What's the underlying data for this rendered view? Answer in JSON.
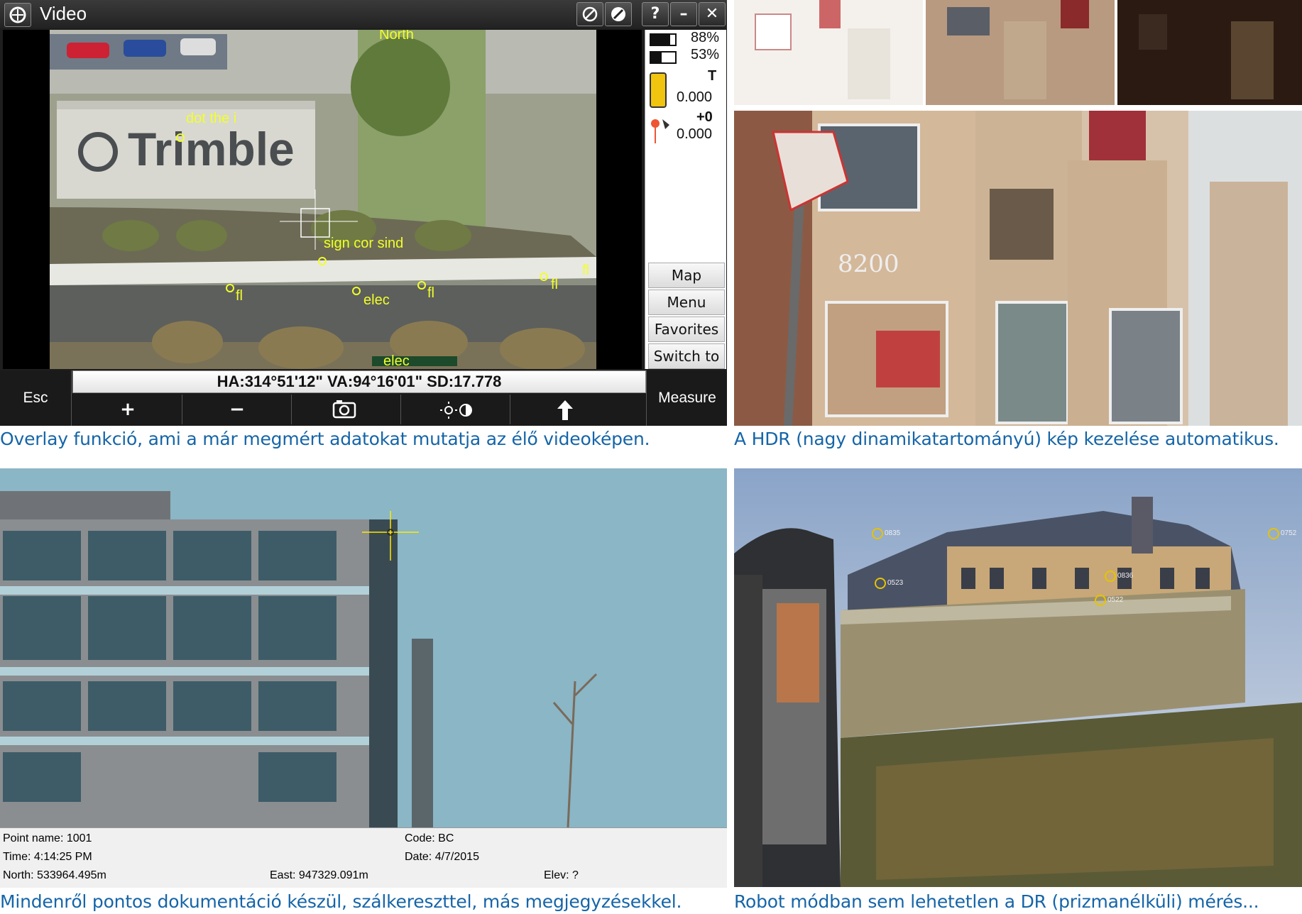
{
  "video_window": {
    "title": "Video",
    "side_panel": {
      "battery_1": "88%",
      "battery_2": "53%",
      "mode": "T",
      "value_1": "0.000",
      "offset": "+0",
      "value_2": "0.000",
      "buttons": [
        {
          "label": "Map"
        },
        {
          "label": "Menu"
        },
        {
          "label": "Favorites"
        },
        {
          "label": "Switch to"
        }
      ]
    },
    "readout": "HA:314°51'12\"  VA:94°16'01\"  SD:17.778",
    "esc_label": "Esc",
    "measure_label": "Measure",
    "tools": [
      "+",
      "−"
    ],
    "overlay_labels": {
      "north": "North",
      "dot": "dot the i",
      "sign": "sign cor sind",
      "fl_1": "fl",
      "elec_1": "elec",
      "fl_2": "fl",
      "fl_3": "fl",
      "fl_4": "fl",
      "elec_2": "elec"
    },
    "sign_text": "Trimble"
  },
  "hdr_panel": {
    "building_number": "8200"
  },
  "doc_panel": {
    "point_name": "Point name: 1001",
    "time": "Time: 4:14:25 PM",
    "north": "North: 533964.495m",
    "code": "Code: BC",
    "date": "Date: 4/7/2015",
    "east": "East: 947329.091m",
    "elev": "Elev: ?"
  },
  "robot_panel": {
    "tags": [
      "0835",
      "0836",
      "0523",
      "0522",
      "0752"
    ]
  },
  "captions": {
    "overlay": "Overlay funkció, ami a már megmért adatokat mutatja az élő videoképen.",
    "hdr": "A HDR (nagy dinamikatartományú) kép kezelése automatikus.",
    "doc": "Mindenről pontos dokumentáció készül, szálkereszttel, más megjegyzésekkel.",
    "robot": "Robot módban sem lehetetlen a DR (prizmanélküli) mérés..."
  },
  "colors": {
    "caption": "#1565a8",
    "overlay": "#f2ff2a"
  }
}
